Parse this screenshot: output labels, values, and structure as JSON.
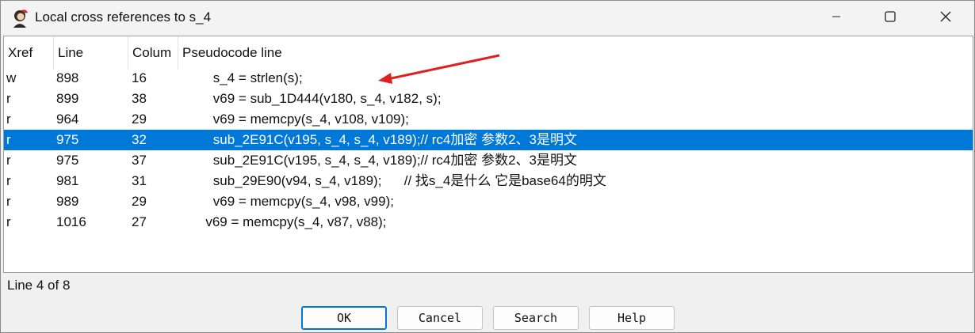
{
  "window": {
    "title": "Local cross references to s_4",
    "app_icon": "portrait-icon",
    "controls": [
      "minimize-icon",
      "maximize-icon",
      "close-icon"
    ]
  },
  "table": {
    "columns": [
      "Xref",
      "Line",
      "Colum",
      "Pseudocode line"
    ],
    "selected_index": 3,
    "rows": [
      {
        "xref": "w",
        "line": "898",
        "column": "16",
        "code": "        s_4 = strlen(s);"
      },
      {
        "xref": "r",
        "line": "899",
        "column": "38",
        "code": "        v69 = sub_1D444(v180, s_4, v182, s);"
      },
      {
        "xref": "r",
        "line": "964",
        "column": "29",
        "code": "        v69 = memcpy(s_4, v108, v109);"
      },
      {
        "xref": "r",
        "line": "975",
        "column": "32",
        "code": "        sub_2E91C(v195, s_4, s_4, v189);// rc4加密 参数2、3是明文"
      },
      {
        "xref": "r",
        "line": "975",
        "column": "37",
        "code": "        sub_2E91C(v195, s_4, s_4, v189);// rc4加密 参数2、3是明文"
      },
      {
        "xref": "r",
        "line": "981",
        "column": "31",
        "code": "        sub_29E90(v94, s_4, v189);      // 找s_4是什么 它是base64的明文"
      },
      {
        "xref": "r",
        "line": "989",
        "column": "29",
        "code": "        v69 = memcpy(s_4, v98, v99);"
      },
      {
        "xref": "r",
        "line": "1016",
        "column": "27",
        "code": "      v69 = memcpy(s_4, v87, v88);"
      }
    ]
  },
  "annotation": {
    "color": "#e02020"
  },
  "status": {
    "text": "Line 4 of 8"
  },
  "buttons": {
    "ok": "OK",
    "cancel": "Cancel",
    "search": "Search",
    "help": "Help"
  },
  "colors": {
    "selection": "#0078d7",
    "focus": "#0078d7"
  }
}
